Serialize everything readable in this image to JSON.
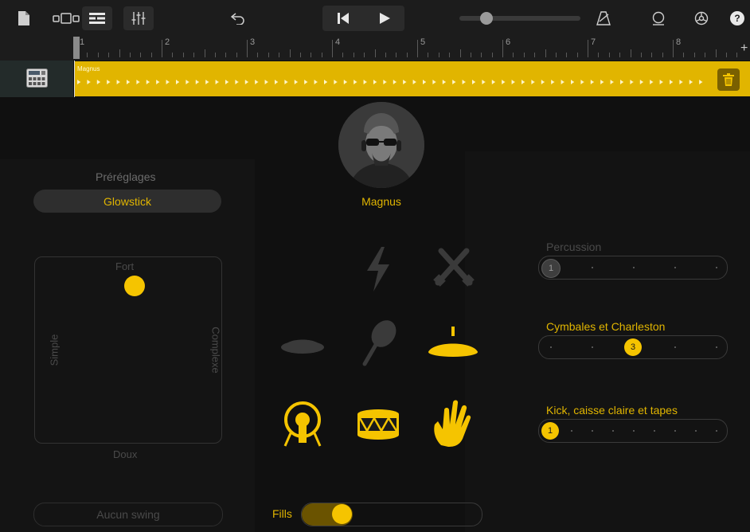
{
  "toolbar": {
    "icons": [
      "document-icon",
      "track-view-icon",
      "tracks-list-icon",
      "mixer-icon",
      "undo-icon",
      "go-to-start-icon",
      "play-icon",
      "metronome-icon",
      "loop-icon",
      "settings-icon",
      "help-icon"
    ],
    "volume": 0.18,
    "help_label": "?"
  },
  "ruler": {
    "bars": [
      "1",
      "2",
      "3",
      "4",
      "5",
      "6",
      "7",
      "8"
    ],
    "plus_label": "+"
  },
  "track": {
    "region_name": "Magnus"
  },
  "presets": {
    "label": "Préréglages",
    "selected": "Glowstick"
  },
  "drummer": {
    "name": "Magnus"
  },
  "xy_pad": {
    "top_label": "Fort",
    "bottom_label": "Doux",
    "left_label": "Simple",
    "right_label": "Complexe",
    "complexity": 0.49,
    "loudness": 0.87
  },
  "instruments": [
    {
      "name": "clap",
      "active": false
    },
    {
      "name": "sticks",
      "active": false
    },
    {
      "name": "tambourine",
      "active": false
    },
    {
      "name": "shaker",
      "active": false
    },
    {
      "name": "cymbal",
      "active": true
    },
    {
      "name": "kick",
      "active": true
    },
    {
      "name": "snare",
      "active": true
    },
    {
      "name": "hand-clap",
      "active": true
    }
  ],
  "sliders": [
    {
      "title": "Percussion",
      "value": "1",
      "position": 1,
      "steps": 5,
      "active": false
    },
    {
      "title": "Cymbales et Charleston",
      "value": "3",
      "position": 3,
      "steps": 5,
      "active": true
    },
    {
      "title": "Kick, caisse claire et tapes",
      "value": "1",
      "position": 1,
      "steps": 9,
      "active": true
    }
  ],
  "swing": {
    "label": "Aucun swing"
  },
  "fills": {
    "label": "Fills",
    "level": 0.17
  },
  "colors": {
    "accent": "#E1B500",
    "accent_bright": "#F5C400",
    "background": "#101010"
  }
}
